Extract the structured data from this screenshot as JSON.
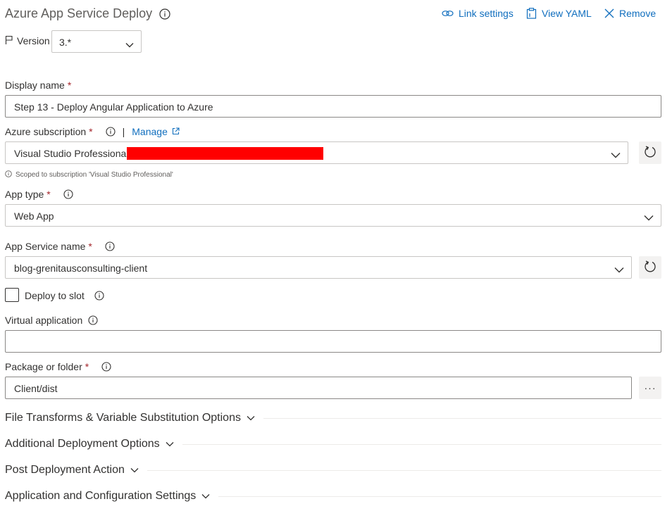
{
  "header": {
    "title": "Azure App Service Deploy",
    "link_settings": "Link settings",
    "view_yaml": "View YAML",
    "remove": "Remove"
  },
  "version": {
    "label": "Version",
    "value": "3.*"
  },
  "display_name": {
    "label": "Display name",
    "required": "*",
    "value": "Step 13 - Deploy Angular Application to Azure"
  },
  "azure_subscription": {
    "label": "Azure subscription",
    "required": "*",
    "separator": "|",
    "manage": "Manage",
    "value": "Visual Studio Professional",
    "scoped_note": "Scoped to subscription 'Visual Studio Professional'"
  },
  "app_type": {
    "label": "App type",
    "required": "*",
    "value": "Web App"
  },
  "app_service_name": {
    "label": "App Service name",
    "required": "*",
    "value": "blog-grenitausconsulting-client"
  },
  "deploy_to_slot": {
    "label": "Deploy to slot",
    "checked": false
  },
  "virtual_application": {
    "label": "Virtual application",
    "value": ""
  },
  "package_or_folder": {
    "label": "Package or folder",
    "required": "*",
    "value": "Client/dist",
    "browse": "···"
  },
  "sections": [
    {
      "label": "File Transforms & Variable Substitution Options"
    },
    {
      "label": "Additional Deployment Options"
    },
    {
      "label": "Post Deployment Action"
    },
    {
      "label": "Application and Configuration Settings"
    }
  ],
  "colors": {
    "accent": "#106ebe",
    "required": "#a4262c",
    "redaction": "#ff0000"
  }
}
